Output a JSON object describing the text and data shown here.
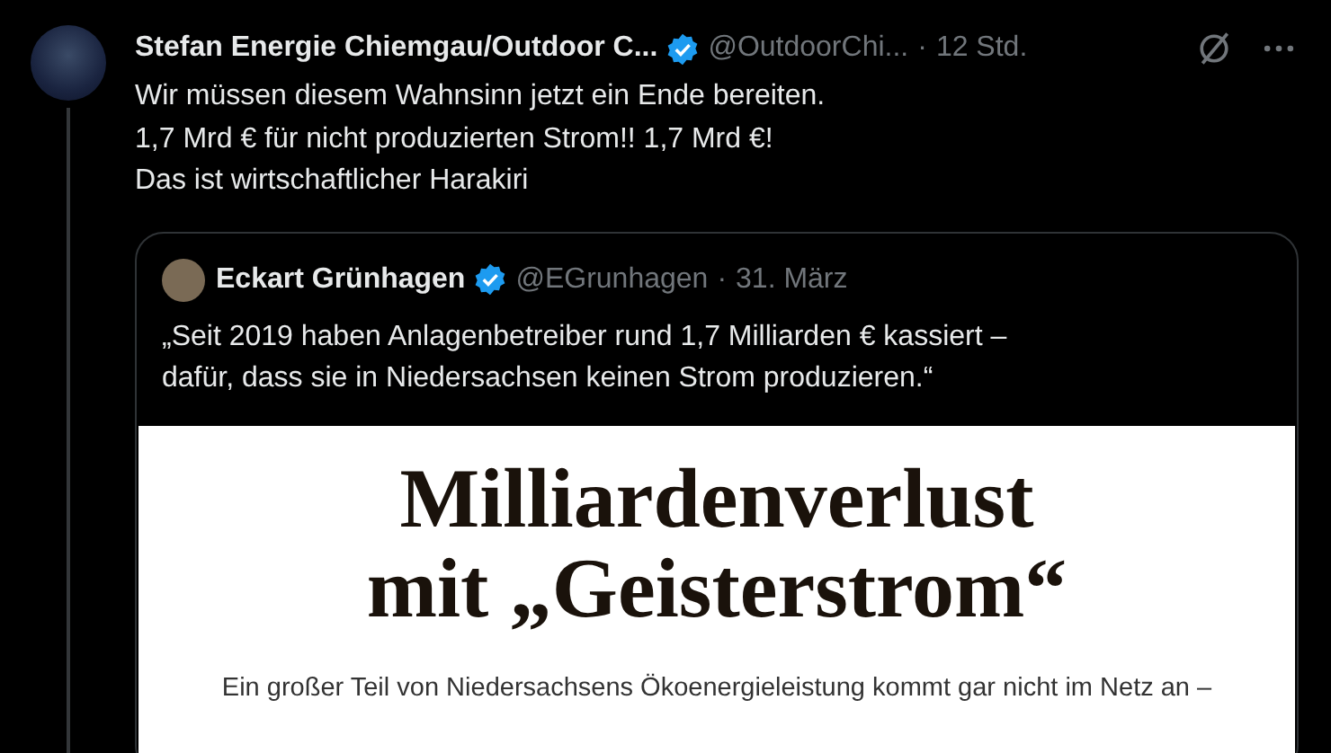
{
  "post": {
    "author": {
      "name": "Stefan Energie Chiemgau/Outdoor C...",
      "verified": true,
      "handle": "@OutdoorChi...",
      "separator": "·",
      "time": "12 Std."
    },
    "text_lines": [
      "Wir müssen diesem Wahnsinn jetzt ein Ende bereiten.",
      "1,7 Mrd € für nicht produzierten Strom!! 1,7 Mrd €!",
      "Das ist wirtschaftlicher Harakiri"
    ]
  },
  "quote": {
    "author": {
      "name": "Eckart Grünhagen",
      "verified": true,
      "handle": "@EGrunhagen",
      "separator": "·",
      "time": "31. März"
    },
    "text_lines": [
      "„Seit 2019 haben Anlagenbetreiber rund 1,7 Milliarden € kassiert –",
      "dafür, dass sie in Niedersachsen keinen Strom produzieren.“"
    ],
    "image": {
      "headline_lines": [
        "Milliardenverlust",
        "mit „Geisterstrom“"
      ],
      "subtitle": "Ein großer Teil von Niedersachsens Ökoenergieleistung kommt gar nicht im Netz an –"
    }
  }
}
